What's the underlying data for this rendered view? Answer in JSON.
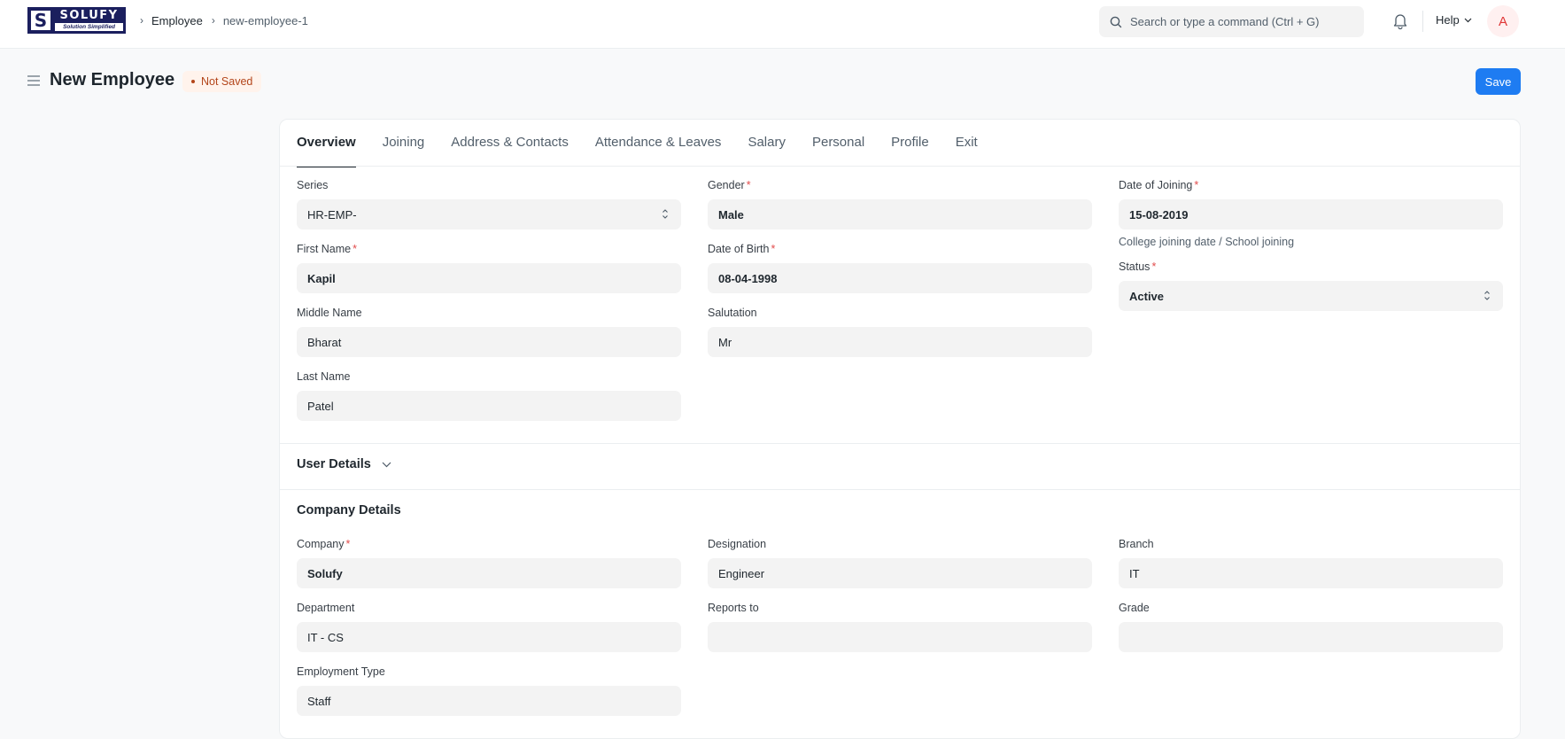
{
  "navbar": {
    "logo": {
      "word": "SOLUFY",
      "tagline": "Solution Simplified",
      "mark": "S"
    },
    "breadcrumbs": [
      "Employee",
      "new-employee-1"
    ],
    "search_placeholder": "Search or type a command (Ctrl + G)",
    "help_label": "Help",
    "avatar_initial": "A"
  },
  "page": {
    "title": "New Employee",
    "status_badge": "Not Saved",
    "save_label": "Save"
  },
  "tabs": [
    {
      "label": "Overview",
      "active": true
    },
    {
      "label": "Joining"
    },
    {
      "label": "Address & Contacts"
    },
    {
      "label": "Attendance & Leaves"
    },
    {
      "label": "Salary"
    },
    {
      "label": "Personal"
    },
    {
      "label": "Profile"
    },
    {
      "label": "Exit"
    }
  ],
  "overview": {
    "series": {
      "label": "Series",
      "value": "HR-EMP-"
    },
    "first_name": {
      "label": "First Name",
      "value": "Kapil"
    },
    "middle_name": {
      "label": "Middle Name",
      "value": "Bharat"
    },
    "last_name": {
      "label": "Last Name",
      "value": "Patel"
    },
    "gender": {
      "label": "Gender",
      "value": "Male"
    },
    "date_of_birth": {
      "label": "Date of Birth",
      "value": "08-04-1998"
    },
    "salutation": {
      "label": "Salutation",
      "value": "Mr"
    },
    "date_of_joining": {
      "label": "Date of Joining",
      "value": "15-08-2019",
      "help": "College joining date / School joining"
    },
    "status": {
      "label": "Status",
      "value": "Active"
    }
  },
  "user_details": {
    "title": "User Details"
  },
  "company_details": {
    "title": "Company Details",
    "company": {
      "label": "Company",
      "value": "Solufy"
    },
    "department": {
      "label": "Department",
      "value": "IT - CS"
    },
    "employment_type": {
      "label": "Employment Type",
      "value": "Staff"
    },
    "designation": {
      "label": "Designation",
      "value": "Engineer"
    },
    "reports_to": {
      "label": "Reports to",
      "value": ""
    },
    "branch": {
      "label": "Branch",
      "value": "IT"
    },
    "grade": {
      "label": "Grade",
      "value": ""
    }
  },
  "required_marker": "*",
  "colors": {
    "primary": "#1e7cf2",
    "badge_text": "#b3451a",
    "badge_bg": "#fff3ec",
    "required": "#e24c4c",
    "brand_navy": "#1b1f5e"
  }
}
